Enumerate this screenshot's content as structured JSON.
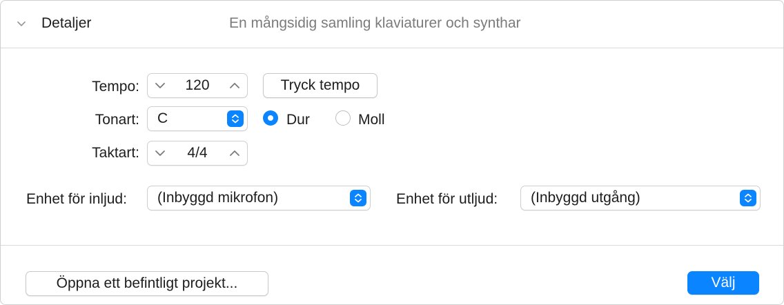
{
  "header": {
    "title": "Detaljer",
    "subtitle": "En mångsidig samling klaviaturer och synthar",
    "disclosure_icon": "chevron-down-icon"
  },
  "tempo": {
    "label": "Tempo:",
    "value": "120",
    "tap_button": "Tryck tempo"
  },
  "key": {
    "label": "Tonart:",
    "value": "C",
    "major_label": "Dur",
    "minor_label": "Moll",
    "selected": "Dur"
  },
  "time_signature": {
    "label": "Taktart:",
    "value": "4/4"
  },
  "input_device": {
    "label": "Enhet för inljud:",
    "value": "(Inbyggd mikrofon)"
  },
  "output_device": {
    "label": "Enhet för utljud:",
    "value": "(Inbyggd utgång)"
  },
  "footer": {
    "open_existing": "Öppna ett befintligt projekt...",
    "choose": "Välj"
  },
  "colors": {
    "accent": "#0a84ff",
    "border": "#cfcfcf",
    "secondary_text": "#7b7b7b"
  }
}
